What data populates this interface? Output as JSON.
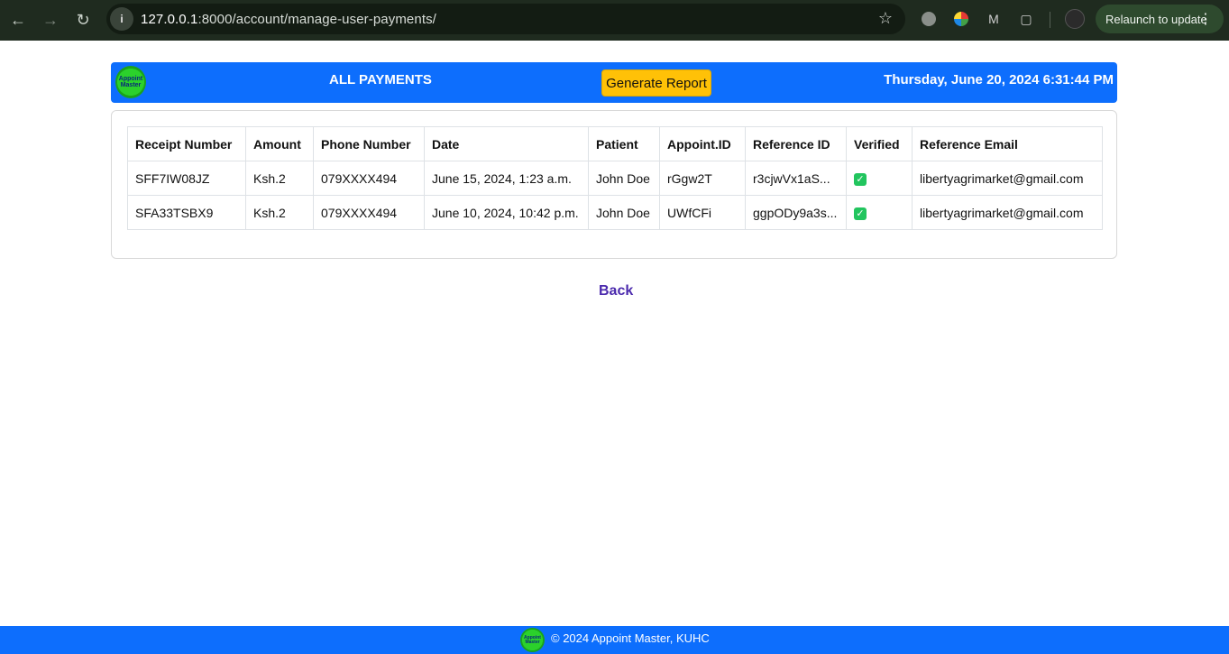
{
  "browser": {
    "url_host": "127.0.0.1",
    "url_rest": ":8000/account/manage-user-payments/",
    "relaunch_label": "Relaunch to update"
  },
  "header": {
    "logo_text": "Appoint Master",
    "title": "ALL PAYMENTS",
    "generate_button": "Generate Report",
    "datetime": "Thursday, June 20, 2024 6:31:44 PM",
    "colors": {
      "bar": "#0d6efd",
      "button": "#ffc107"
    }
  },
  "table": {
    "columns": [
      "Receipt Number",
      "Amount",
      "Phone Number",
      "Date",
      "Patient",
      "Appoint.ID",
      "Reference ID",
      "Verified",
      "Reference Email"
    ],
    "rows": [
      {
        "receipt": "SFF7IW08JZ",
        "amount": "Ksh.2",
        "phone": "079XXXX494",
        "date": "June 15, 2024, 1:23 a.m.",
        "patient": "John Doe",
        "appoint_id": "rGgw2T",
        "reference_id": "r3cjwVx1aS...",
        "verified": true,
        "email": "libertyagrimarket@gmail.com"
      },
      {
        "receipt": "SFA33TSBX9",
        "amount": "Ksh.2",
        "phone": "079XXXX494",
        "date": "June 10, 2024, 10:42 p.m.",
        "patient": "John Doe",
        "appoint_id": "UWfCFi",
        "reference_id": "ggpODy9a3s...",
        "verified": true,
        "email": "libertyagrimarket@gmail.com"
      }
    ]
  },
  "back_link": "Back",
  "footer": {
    "logo_text": "Appoint Master",
    "text": "© 2024 Appoint Master, KUHC"
  }
}
